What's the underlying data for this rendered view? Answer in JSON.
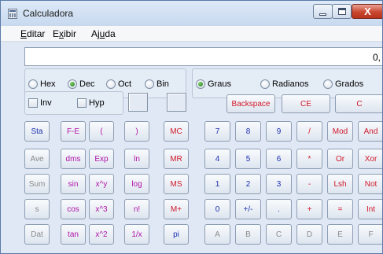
{
  "window": {
    "title": "Calculadora",
    "icon": "calculator-icon",
    "controls": {
      "minimize_icon": "minimize-icon",
      "maximize_icon": "maximize-icon",
      "close_glyph": "X"
    }
  },
  "menu": [
    {
      "pre": "",
      "u": "E",
      "post": "ditar"
    },
    {
      "pre": "E",
      "u": "x",
      "post": "ibir"
    },
    {
      "pre": "Aj",
      "u": "u",
      "post": "da"
    }
  ],
  "display": {
    "value": "0,"
  },
  "base_radios": [
    {
      "label": "Hex",
      "checked": false
    },
    {
      "label": "Dec",
      "checked": true
    },
    {
      "label": "Oct",
      "checked": false
    },
    {
      "label": "Bin",
      "checked": false
    }
  ],
  "angle_radios": [
    {
      "label": "Graus",
      "checked": true
    },
    {
      "label": "Radianos",
      "checked": false
    },
    {
      "label": "Grados",
      "checked": false
    }
  ],
  "checkboxes": [
    {
      "label": "Inv",
      "checked": false
    },
    {
      "label": "Hyp",
      "checked": false
    }
  ],
  "buttons": {
    "top_row": [
      "Backspace",
      "CE",
      "C"
    ],
    "stats": [
      "Sta",
      "Ave",
      "Sum",
      "s",
      "Dat"
    ],
    "sci": [
      [
        "F-E",
        "(",
        ")"
      ],
      [
        "dms",
        "Exp",
        "ln"
      ],
      [
        "sin",
        "x^y",
        "log"
      ],
      [
        "cos",
        "x^3",
        "n!"
      ],
      [
        "tan",
        "x^2",
        "1/x"
      ]
    ],
    "memory": [
      "MC",
      "MR",
      "MS",
      "M+",
      "pi"
    ],
    "digits": [
      [
        "7",
        "8",
        "9",
        "/",
        "Mod",
        "And"
      ],
      [
        "4",
        "5",
        "6",
        "*",
        "Or",
        "Xor"
      ],
      [
        "1",
        "2",
        "3",
        "-",
        "Lsh",
        "Not"
      ],
      [
        "0",
        "+/-",
        ".",
        "+",
        "=",
        "Int"
      ],
      [
        "A",
        "B",
        "C",
        "D",
        "E",
        "F"
      ]
    ]
  },
  "colors": {
    "blue": "#1c2fb0",
    "red": "#d0182a",
    "purple": "#b014a8",
    "gray": "#8a8a8a"
  }
}
